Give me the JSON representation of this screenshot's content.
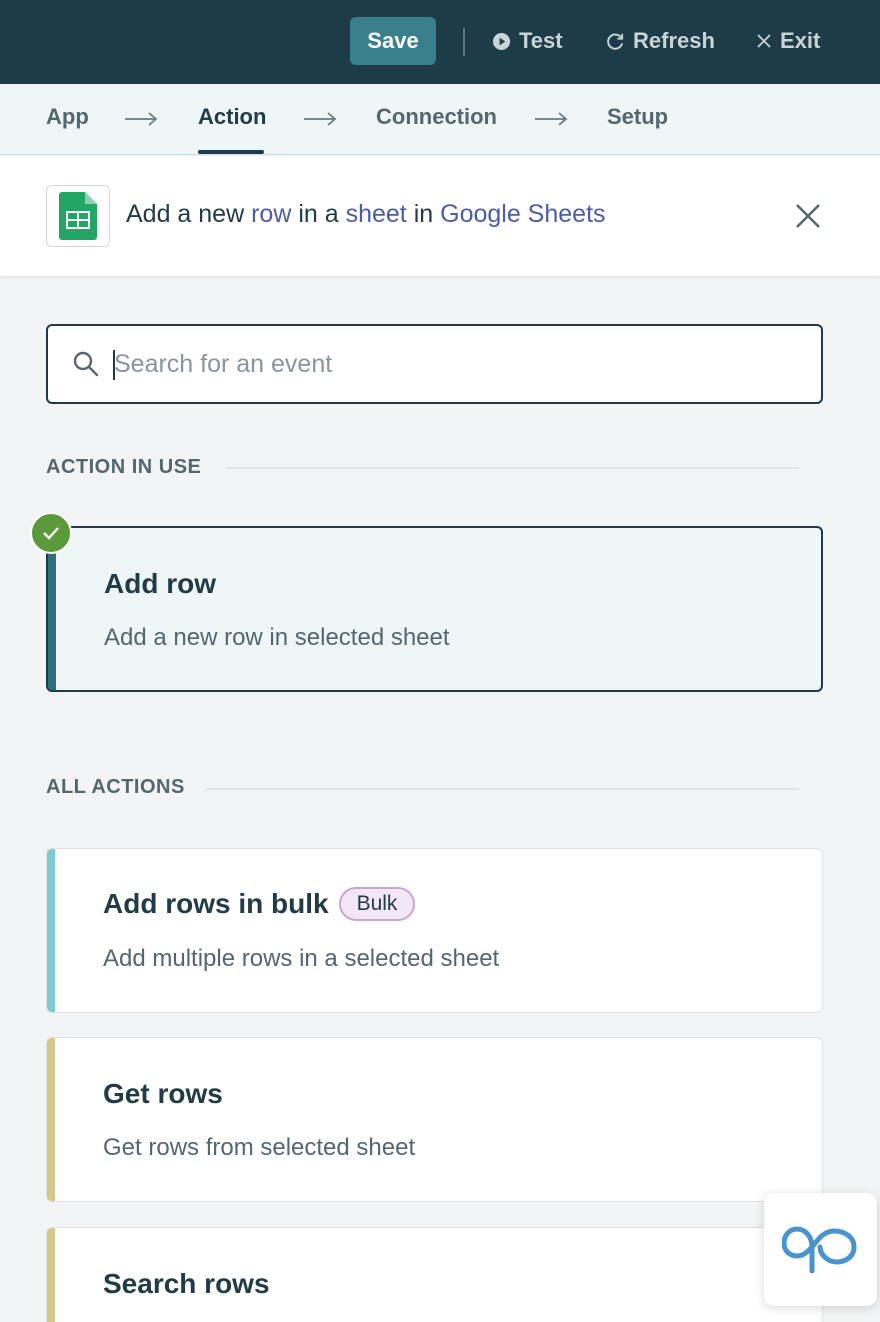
{
  "topbar": {
    "save_label": "Save",
    "test_label": "Test",
    "refresh_label": "Refresh",
    "exit_label": "Exit"
  },
  "stepper": {
    "steps": [
      "App",
      "Action",
      "Connection",
      "Setup"
    ],
    "active": "Action"
  },
  "app_header": {
    "prefix": "Add a new ",
    "object": "row",
    "middle": " in a ",
    "container": "sheet",
    "connector": " in ",
    "app_name": "Google Sheets",
    "logo_icon": "google-sheets-icon"
  },
  "search": {
    "placeholder": "Search for an event",
    "value": ""
  },
  "sections": {
    "in_use": "ACTION IN USE",
    "all": "ALL ACTIONS"
  },
  "action_in_use": {
    "title": "Add row",
    "description": "Add a new row in selected sheet"
  },
  "actions": [
    {
      "title": "Add rows in bulk",
      "badge": "Bulk",
      "description": "Add multiple rows in a selected sheet",
      "accent": "#7fcbd0"
    },
    {
      "title": "Get rows",
      "description": "Get rows from selected sheet",
      "accent": "#d6c88a"
    },
    {
      "title": "Search rows",
      "description": "",
      "accent": "#d6c88a"
    }
  ],
  "colors": {
    "topbar": "#1d3c47",
    "save": "#3a7f8c",
    "selected_bar": "#2f6f7c",
    "check": "#5a9a3a",
    "link": "#4d5ba8"
  }
}
